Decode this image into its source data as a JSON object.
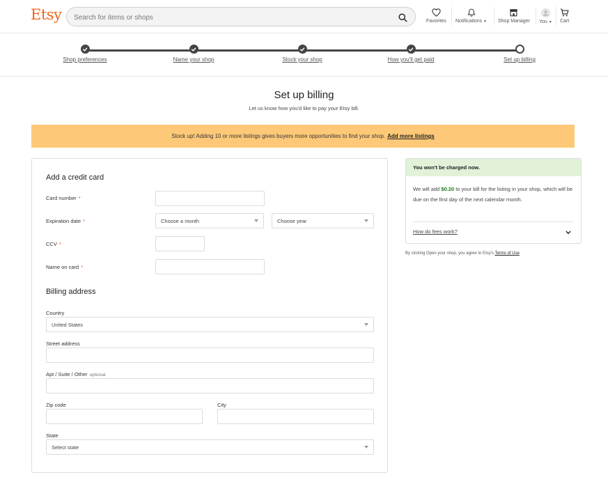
{
  "header": {
    "logo": "Etsy",
    "search_placeholder": "Search for items or shops",
    "nav": {
      "favorites": "Favorites",
      "notifications": "Notifications",
      "shop_manager": "Shop Manager",
      "you": "You",
      "cart": "Cart"
    }
  },
  "progress": {
    "steps": [
      {
        "label": "Shop preferences",
        "status": "complete"
      },
      {
        "label": "Name your shop",
        "status": "complete"
      },
      {
        "label": "Stock your shop",
        "status": "complete"
      },
      {
        "label": "How you'll get paid",
        "status": "complete"
      },
      {
        "label": "Set up billing",
        "status": "current"
      }
    ]
  },
  "page": {
    "title": "Set up billing",
    "subtitle": "Let us know how you'd like to pay your Etsy bill."
  },
  "banner": {
    "text": "Stock up! Adding 10 or more listings gives buyers more opportunities to find your shop.",
    "link": "Add more listings",
    "color": "#fdc978"
  },
  "credit_card": {
    "title": "Add a credit card",
    "card_number_label": "Card number",
    "card_number_value": "",
    "expiration_label": "Expiration date",
    "month_placeholder": "Choose a month",
    "year_placeholder": "Choose year",
    "ccv_label": "CCV",
    "ccv_value": "",
    "name_label": "Name on card",
    "name_value": "",
    "required_mark": "*"
  },
  "billing": {
    "title": "Billing address",
    "country_label": "Country",
    "country_value": "United States",
    "street_label": "Street address",
    "street_value": "",
    "apt_label": "Apt / Suite / Other",
    "apt_optional": "optional",
    "apt_value": "",
    "zip_label": "Zip code",
    "zip_value": "",
    "city_label": "City",
    "city_value": "",
    "state_label": "State",
    "state_placeholder": "Select state"
  },
  "info": {
    "header": "You won't be charged now.",
    "body_pre": "We will add",
    "amount": "$0.20",
    "body_post": "to your bill for the listing in your shop, which will be due on the first day of the next calendar month.",
    "faq": "How do fees work?",
    "header_bg": "#e1f2d9",
    "amount_color": "#1f7a1f"
  },
  "terms": {
    "text": "By clicking Open your shop, you agree to Etsy's",
    "link": "Terms of Use",
    "end": "."
  },
  "colors": {
    "brand": "#f1641e",
    "required": "#e35b00"
  }
}
